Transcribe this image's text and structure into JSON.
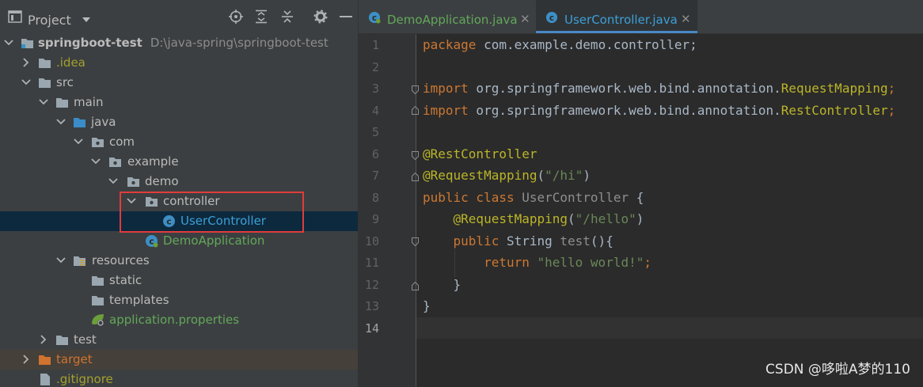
{
  "project_panel": {
    "title": "Project",
    "toolbar_icons": [
      "locate-icon",
      "expand-all-icon",
      "collapse-all-icon",
      "gear-icon",
      "minimize-icon"
    ]
  },
  "tree": {
    "root_name": "springboot-test",
    "root_path": "D:\\java-spring\\springboot-test",
    "idea": ".idea",
    "src": "src",
    "main": "main",
    "java": "java",
    "com": "com",
    "example": "example",
    "demo": "demo",
    "controller": "controller",
    "user_controller": "UserController",
    "demo_application": "DemoApplication",
    "resources": "resources",
    "static": "static",
    "templates": "templates",
    "application_properties": "application.properties",
    "test": "test",
    "target": "target",
    "gitignore": ".gitignore"
  },
  "editor": {
    "tabs": [
      {
        "label": "DemoApplication.java",
        "active": false
      },
      {
        "label": "UserController.java",
        "active": true
      }
    ],
    "line_numbers": [
      "1",
      "2",
      "3",
      "4",
      "5",
      "6",
      "7",
      "8",
      "9",
      "10",
      "11",
      "12",
      "13",
      "14"
    ],
    "code": {
      "l1_kw": "package",
      "l1_rest": " com.example.demo.controller;",
      "l3_kw": "import",
      "l3_pkg": " org.springframework.web.bind.annotation.",
      "l3_cls": "RequestMapping",
      "l3_end": ";",
      "l4_kw": "import",
      "l4_pkg": " org.springframework.web.bind.annotation.",
      "l4_cls": "RestController",
      "l4_end": ";",
      "l6_ann": "@RestController",
      "l7_ann": "@RequestMapping",
      "l7_open": "(",
      "l7_str": "\"/hi\"",
      "l7_close": ")",
      "l8_kw": "public class",
      "l8_name": " UserController ",
      "l8_brace": "{",
      "l9_ann": "@RequestMapping",
      "l9_open": "(",
      "l9_str": "\"/hello\"",
      "l9_close": ")",
      "l10_kw": "public",
      "l10_type": " String ",
      "l10_name": "test",
      "l10_rest": "(){",
      "l11_kw": "return",
      "l11_str": " \"hello world!\"",
      "l11_end": ";",
      "l12": "}",
      "l13": "}"
    }
  },
  "watermark": "CSDN @哆啦A梦的110",
  "colors": {
    "panel_bg": "#3c3f41",
    "editor_bg": "#2b2b2b",
    "selection": "#0d293e",
    "highlight_box": "#e03c3c",
    "keyword": "#cc7832",
    "annotation": "#bbb529",
    "string": "#6a8759"
  }
}
